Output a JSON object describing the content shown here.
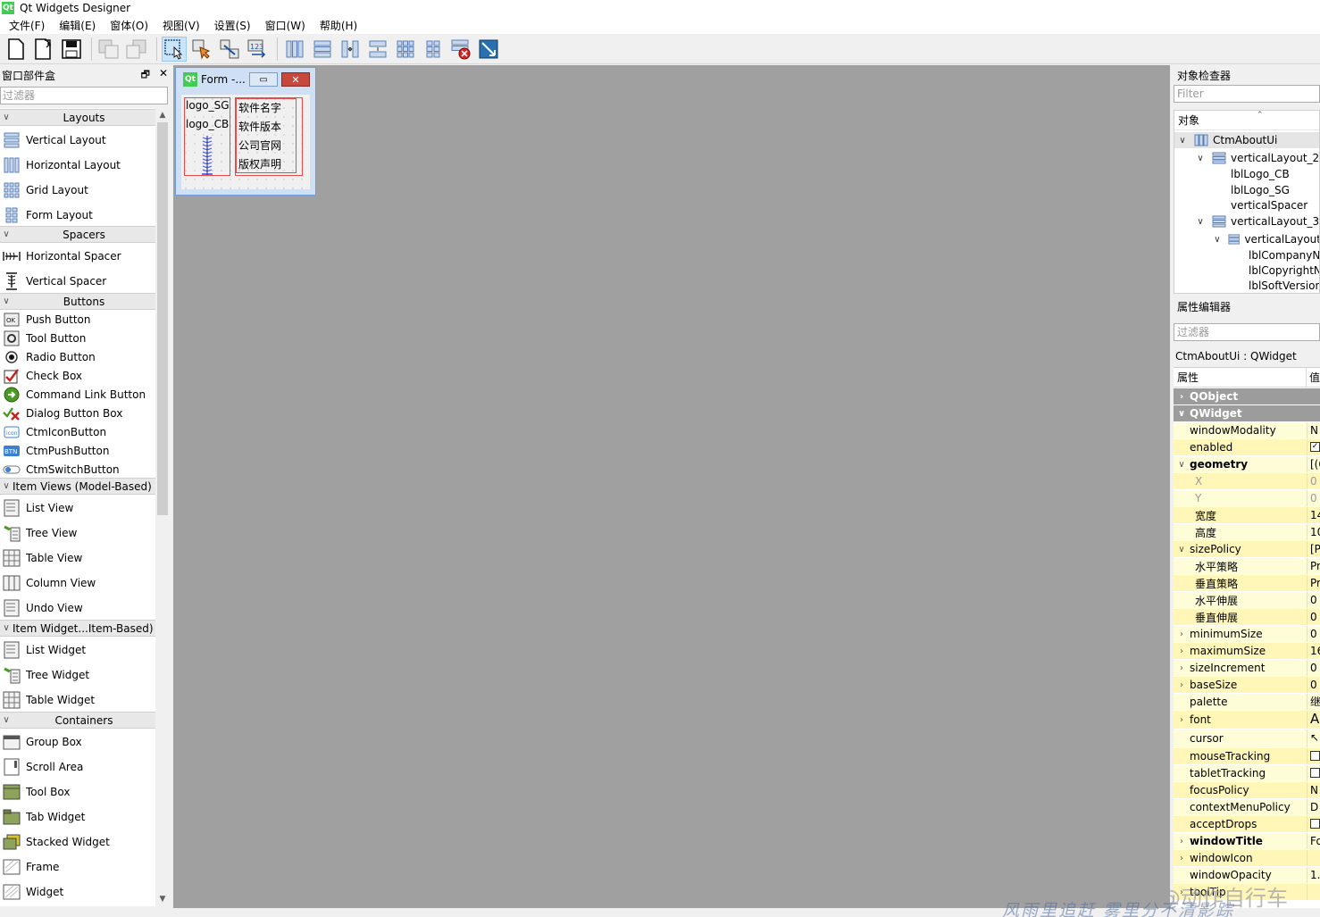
{
  "window": {
    "logo": "Qt",
    "title": "Qt Widgets Designer"
  },
  "menu": [
    "文件(F)",
    "编辑(E)",
    "窗体(O)",
    "视图(V)",
    "设置(S)",
    "窗口(W)",
    "帮助(H)"
  ],
  "widget_box": {
    "title": "窗口部件盒",
    "filter_placeholder": "过滤器",
    "categories": {
      "layouts": "Layouts",
      "spacers": "Spacers",
      "buttons": "Buttons",
      "item_views": "Item Views (Model-Based)",
      "item_widgets": "Item Widget...Item-Based)",
      "containers": "Containers"
    },
    "items": {
      "vertical_layout": "Vertical Layout",
      "horizontal_layout": "Horizontal Layout",
      "grid_layout": "Grid Layout",
      "form_layout": "Form Layout",
      "horizontal_spacer": "Horizontal Spacer",
      "vertical_spacer": "Vertical Spacer",
      "push_button": "Push Button",
      "tool_button": "Tool Button",
      "radio_button": "Radio Button",
      "check_box": "Check Box",
      "command_link_button": "Command Link Button",
      "dialog_button_box": "Dialog Button Box",
      "ctm_icon_button": "CtmIconButton",
      "ctm_push_button": "CtmPushButton",
      "ctm_switch_button": "CtmSwitchButton",
      "list_view": "List View",
      "tree_view": "Tree View",
      "table_view": "Table View",
      "column_view": "Column View",
      "undo_view": "Undo View",
      "list_widget": "List Widget",
      "tree_widget": "Tree Widget",
      "table_widget": "Table Widget",
      "group_box": "Group Box",
      "scroll_area": "Scroll Area",
      "tool_box": "Tool Box",
      "tab_widget": "Tab Widget",
      "stacked_widget": "Stacked Widget",
      "frame": "Frame",
      "widget": "Widget"
    }
  },
  "form": {
    "logo": "Qt",
    "title": "Form -...",
    "close_glyph": "✕",
    "minimize_glyph": "▭",
    "left_labels": [
      "logo_SG",
      "logo_CB"
    ],
    "right_labels": [
      "软件名字",
      "软件版本",
      "公司官网",
      "版权声明"
    ]
  },
  "object_inspector": {
    "title": "对象检查器",
    "filter_placeholder": "Filter",
    "column": "对象",
    "rows": [
      "CtmAboutUi",
      "verticalLayout_2",
      "lblLogo_CB",
      "lblLogo_SG",
      "verticalSpacer",
      "verticalLayout_3",
      "verticalLayout",
      "lblCompanyName",
      "lblCopyrightN",
      "lblSoftVersion"
    ]
  },
  "property_editor": {
    "title": "属性编辑器",
    "filter_placeholder": "过滤器",
    "class_label": "CtmAboutUi : QWidget",
    "col_property": "属性",
    "col_value": "值",
    "rows": {
      "qobject": "QObject",
      "qwidget": "QWidget",
      "windowModality": "windowModality",
      "windowModality_v": "N",
      "enabled": "enabled",
      "geometry": "geometry",
      "geometry_v": "[(0",
      "x": "X",
      "x_v": "0",
      "y": "Y",
      "y_v": "0",
      "width": "宽度",
      "width_v": "14",
      "height": "高度",
      "height_v": "10",
      "sizePolicy": "sizePolicy",
      "sizePolicy_v": "[P",
      "hpolicy": "水平策略",
      "hpolicy_v": "Pr",
      "vpolicy": "垂直策略",
      "vpolicy_v": "Pr",
      "hstretch": "水平伸展",
      "hstretch_v": "0",
      "vstretch": "垂直伸展",
      "vstretch_v": "0",
      "minimumSize": "minimumSize",
      "minimumSize_v": "0",
      "maximumSize": "maximumSize",
      "maximumSize_v": "16",
      "sizeIncrement": "sizeIncrement",
      "sizeIncrement_v": "0",
      "baseSize": "baseSize",
      "baseSize_v": "0",
      "palette": "palette",
      "palette_v": "继",
      "font": "font",
      "font_v": "A",
      "cursor": "cursor",
      "mouseTracking": "mouseTracking",
      "tabletTracking": "tabletTracking",
      "focusPolicy": "focusPolicy",
      "focusPolicy_v": "N",
      "contextMenuPolicy": "contextMenuPolicy",
      "contextMenuPolicy_v": "D",
      "acceptDrops": "acceptDrops",
      "windowTitle": "windowTitle",
      "windowTitle_v": "Fo",
      "windowIcon": "windowIcon",
      "windowOpacity": "windowOpacity",
      "windowOpacity_v": "1.",
      "toolTip": "toolTip"
    }
  },
  "watermark": {
    "line1": "CSDN @动作自行车",
    "line2": "风雨里追赶 雾里分不清影踪"
  },
  "colors": {
    "canvas": "#a0a0a0",
    "group_row": "#9c9c9c",
    "prop_yellow": "#fffcd8",
    "layout_red": "#e74c4c",
    "qt_green": "#41cd52"
  }
}
